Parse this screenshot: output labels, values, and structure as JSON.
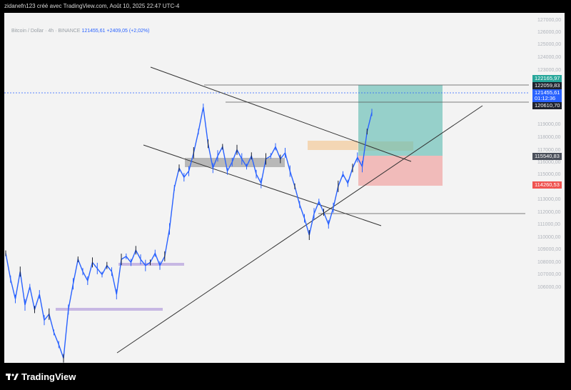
{
  "header": {
    "caption": "zidanefn123 créé avec TradingView.com, Août 10, 2025 22:47 UTC-4"
  },
  "symbol_bar": {
    "name": "Bitcoin / Dollar · 4h · BINANCE",
    "price": "121455,61",
    "change": "+2409,05 (+2,02%)"
  },
  "price_tags": {
    "tp": "122165,97",
    "high": "122059,83",
    "last": "121455,61",
    "countdown": "01:12:36",
    "level": "120610,70",
    "entry": "115540,83",
    "stop": "114260,53"
  },
  "colors": {
    "tp": "#26a69a",
    "stop": "#ef5350",
    "last": "#2962ff",
    "dark": "#1e222d",
    "candle": "#2962ff"
  },
  "footer": {
    "brand": "TradingView"
  },
  "chart_data": {
    "type": "line",
    "title": "Bitcoin / Dollar · 4h · BINANCE",
    "ylim": [
      105000,
      128000
    ],
    "yticks": [
      "127000,00",
      "126000,00",
      "125000,00",
      "124000,00",
      "123000,00",
      "119000,00",
      "118000,00",
      "117000,00",
      "116000,00",
      "115000,00",
      "114000,00",
      "113000,00",
      "112000,00",
      "111000,00",
      "110000,00",
      "109000,00",
      "108000,00",
      "107000,00",
      "106000,00"
    ],
    "series": [
      {
        "name": "BTCUSD",
        "values": [
          112200,
          110500,
          109200,
          111000,
          108800,
          110000,
          108500,
          109500,
          107800,
          108200,
          107000,
          106200,
          105300,
          108500,
          110200,
          111800,
          111000,
          110400,
          111600,
          111200,
          110800,
          111400,
          111000,
          109500,
          111800,
          112000,
          111600,
          112400,
          111800,
          111400,
          111600,
          112200,
          111400,
          112000,
          113800,
          116500,
          117800,
          117200,
          117600,
          118800,
          120200,
          121800,
          119400,
          117800,
          118600,
          119200,
          117600,
          118200,
          119000,
          118400,
          117900,
          118600,
          117400,
          116800,
          118400,
          118600,
          119200,
          118400,
          118800,
          117600,
          116600,
          115400,
          114500,
          113400,
          114800,
          115600,
          114900,
          114100,
          115200,
          116600,
          117400,
          116800,
          117800,
          118500,
          117900,
          120200,
          121455.61
        ]
      }
    ],
    "levels": [
      {
        "label": "122165,97"
      },
      {
        "label": "122059,83"
      },
      {
        "label": "120610,70"
      },
      {
        "label": "115540,83"
      },
      {
        "label": "114260,53"
      }
    ]
  }
}
